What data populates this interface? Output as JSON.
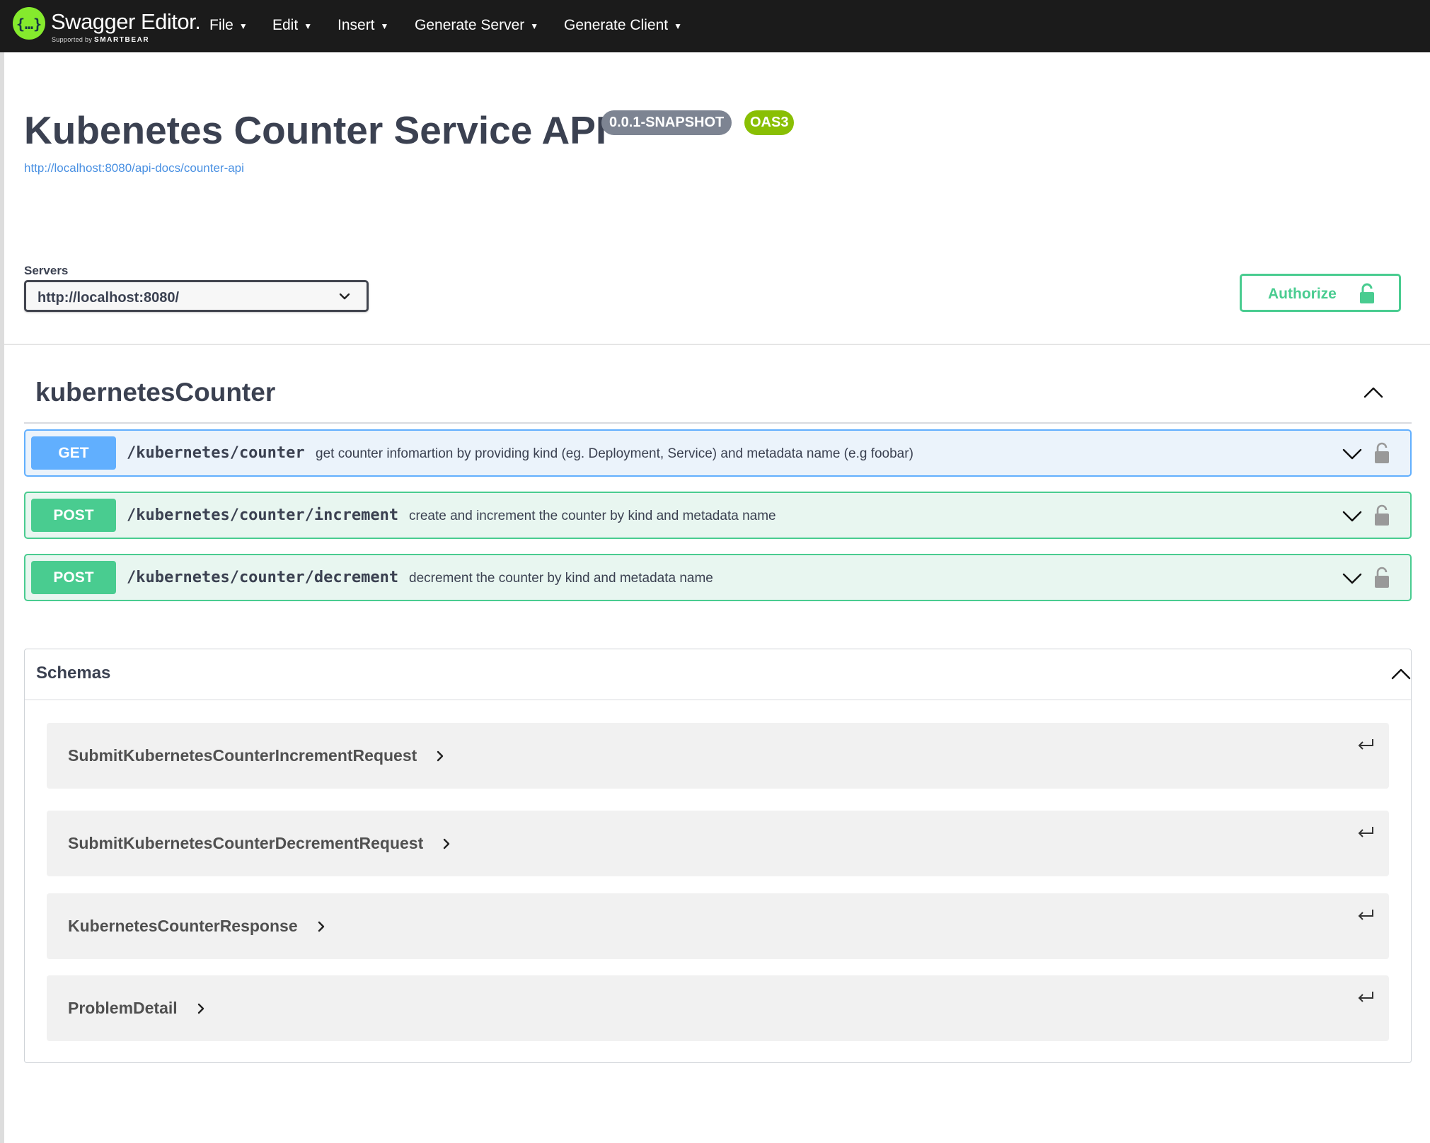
{
  "topbar": {
    "brand": "Swagger Editor.",
    "brand_sub_prefix": "Supported by",
    "brand_sub_company": "SMARTBEAR",
    "menus": [
      {
        "label": "File"
      },
      {
        "label": "Edit"
      },
      {
        "label": "Insert"
      },
      {
        "label": "Generate Server"
      },
      {
        "label": "Generate Client"
      }
    ]
  },
  "info": {
    "title": "Kubenetes Counter Service API",
    "version": "0.0.1-SNAPSHOT",
    "oas": "OAS3",
    "spec_url": "http://localhost:8080/api-docs/counter-api"
  },
  "servers": {
    "label": "Servers",
    "selected": "http://localhost:8080/"
  },
  "authorize": {
    "label": "Authorize"
  },
  "tag": {
    "name": "kubernetesCounter",
    "operations": [
      {
        "method": "GET",
        "path": "/kubernetes/counter",
        "summary": "get counter infomartion by providing kind (eg. Deployment, Service) and metadata name (e.g foobar)"
      },
      {
        "method": "POST",
        "path": "/kubernetes/counter/increment",
        "summary": "create and increment the counter by kind and metadata name"
      },
      {
        "method": "POST",
        "path": "/kubernetes/counter/decrement",
        "summary": "decrement the counter by kind and metadata name"
      }
    ]
  },
  "schemas": {
    "title": "Schemas",
    "models": [
      {
        "name": "SubmitKubernetesCounterIncrementRequest"
      },
      {
        "name": "SubmitKubernetesCounterDecrementRequest"
      },
      {
        "name": "KubernetesCounterResponse"
      },
      {
        "name": "ProblemDetail"
      }
    ]
  },
  "colors": {
    "topbar": "#1b1b1b",
    "logo": "#85ea2d",
    "get": "#61affe",
    "post": "#49cc90",
    "version_badge": "#7d8492",
    "oas_badge": "#89bf04",
    "link": "#4990e2"
  },
  "icons": {
    "logo": "swagger-logo-icon",
    "menu_caret": "caret-down-icon",
    "select": "chevron-down-icon",
    "authorize": "unlocked-padlock-icon",
    "collapse": "chevron-up-icon",
    "op_expand": "chevron-down-icon",
    "op_lock": "lock-icon",
    "model_expand": "chevron-right-icon",
    "model_jump": "return-arrow-icon"
  }
}
